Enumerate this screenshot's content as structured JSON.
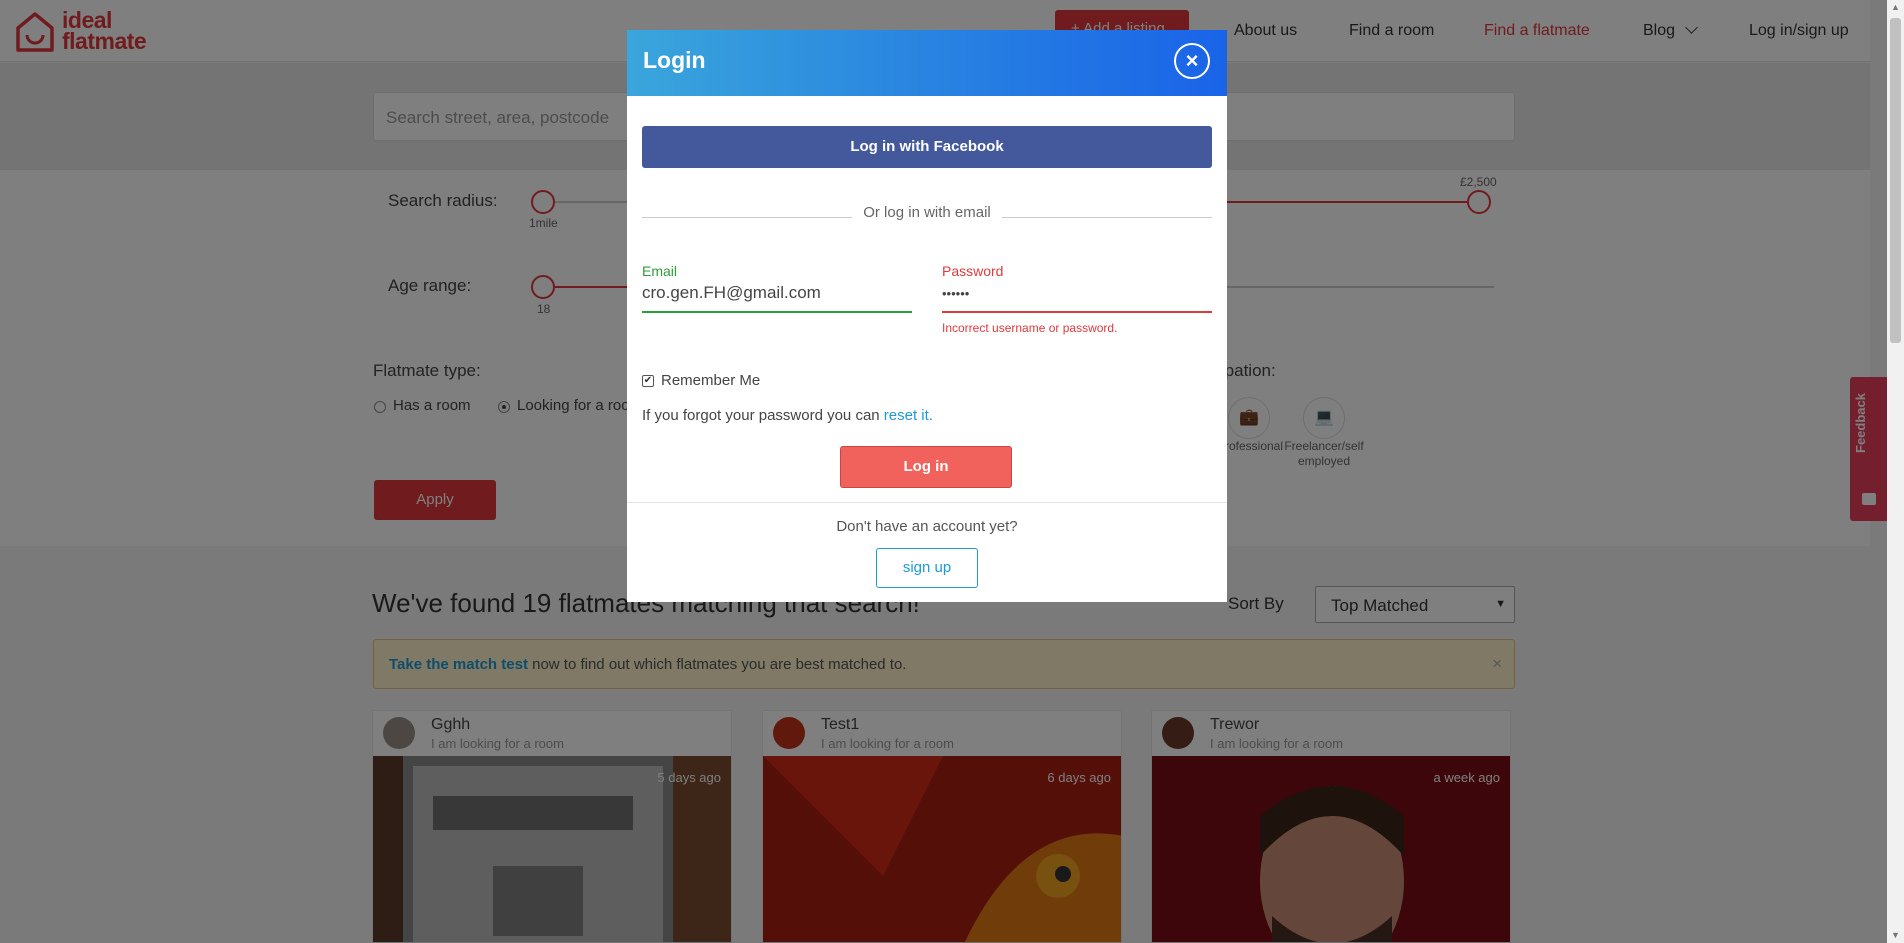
{
  "brand": {
    "line1": "ideal",
    "line2": "flatmate",
    "color": "#e0393e"
  },
  "header": {
    "add_listing": "+ Add a listing",
    "nav": {
      "about": "About us",
      "find_room": "Find a room",
      "find_flatmate": "Find a flatmate",
      "blog": "Blog",
      "login": "Log in/sign up"
    }
  },
  "search": {
    "placeholder": "Search street, area, postcode"
  },
  "filters": {
    "radius_label": "Search radius:",
    "radius_min": "1mile",
    "budget_max": "£2,500",
    "age_label": "Age range:",
    "age_min": "18",
    "flatmate_type_label": "Flatmate type:",
    "has_room": "Has a room",
    "looking_room": "Looking for a room",
    "occupation_label": "Occupation:",
    "occupation_professional": "Professional",
    "occupation_freelancer": "Freelancer/self employed",
    "apply": "Apply"
  },
  "results": {
    "title": "We've found 19 flatmates matching that search!",
    "sort_label": "Sort By",
    "sort_value": "Top Matched",
    "banner_link": "Take the match test",
    "banner_text": " now to find out which flatmates you are best matched to.",
    "banner_close": "×",
    "cards": [
      {
        "name": "Gghh",
        "sub": "I am looking for a room",
        "ago": "5 days ago"
      },
      {
        "name": "Test1",
        "sub": "I am looking for a room",
        "ago": "6 days ago"
      },
      {
        "name": "Trewor",
        "sub": "I am looking for a room",
        "ago": "a week ago"
      }
    ]
  },
  "feedback": {
    "label": "Feedback",
    "color": "#e63e5c"
  },
  "modal": {
    "title": "Login",
    "close": "×",
    "facebook": "Log in with Facebook",
    "or_email": "Or log in with email",
    "email_label": "Email",
    "email_value": "cro.gen.FH@gmail.com",
    "password_label": "Password",
    "password_value": "••••••",
    "password_error": "Incorrect username or password.",
    "remember": "Remember Me",
    "remember_checked": true,
    "forgot_text": "If you forgot your password you can ",
    "forgot_link": "reset it.",
    "login_button": "Log in",
    "no_account": "Don't have an account yet?",
    "signup": "sign up",
    "colors": {
      "email_ok": "#2e9d3a",
      "error": "#e0393e",
      "facebook": "#43599b",
      "primary": "#f0625b",
      "link": "#1e9ad6"
    }
  }
}
